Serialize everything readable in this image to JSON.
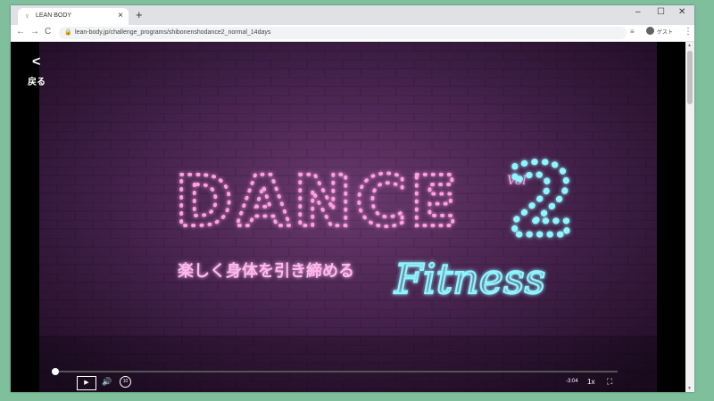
{
  "browser": {
    "tab_title": "LEAN BODY",
    "new_tab_glyph": "+",
    "close_glyph": "×",
    "url": "lean-body.jp/challenge_programs/shibonenshodance2_normal_14days",
    "profile_label": "ゲスト",
    "window_controls": {
      "minimize": "–",
      "maximize": "☐",
      "close": "✕"
    },
    "nav": {
      "back": "←",
      "forward": "→",
      "reload": "C"
    }
  },
  "page": {
    "back_icon": "<",
    "back_label": "戻る"
  },
  "video": {
    "title_main": "DANCE",
    "vol_label": "Vol",
    "vol_number": "2",
    "subtitle_jp": "楽しく身体を引き締める",
    "subtitle_script": "Fitness",
    "colors": {
      "neon_pink": "#ff9fe0",
      "neon_cyan": "#8ff5ff",
      "neon_yellow": "#ffe066",
      "wall": "#3a1a3f"
    }
  },
  "player": {
    "play_glyph": "▶",
    "volume_glyph": "🔊",
    "skip_label": "10",
    "time_remaining": "-3:04",
    "speed_label": "1x",
    "fullscreen_glyph": "⛶",
    "progress_fraction": 0.005
  }
}
